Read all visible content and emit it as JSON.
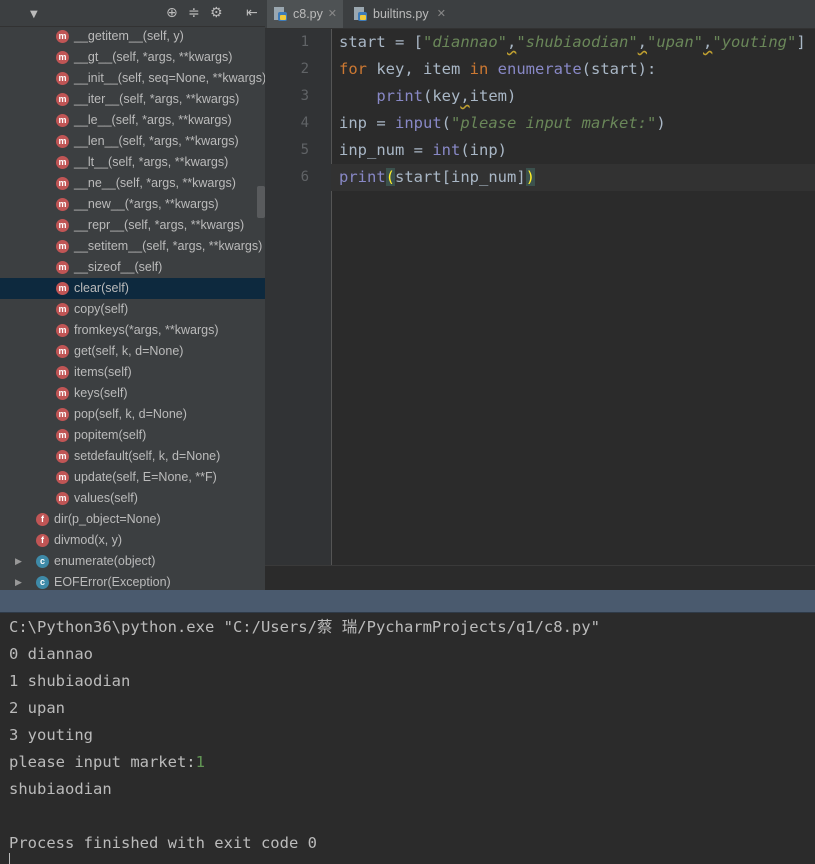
{
  "structure": {
    "toolbar": {
      "collapse_icon": "chevron-down-icon",
      "icons": [
        "target-icon",
        "split-icon",
        "gear-icon",
        "pin-left-icon"
      ]
    },
    "items": [
      {
        "badge": "m",
        "label": "__getitem__(self, y)",
        "indent": 2
      },
      {
        "badge": "m",
        "label": "__gt__(self, *args, **kwargs)",
        "indent": 2
      },
      {
        "badge": "m",
        "label": "__init__(self, seq=None, **kwargs)",
        "indent": 2
      },
      {
        "badge": "m",
        "label": "__iter__(self, *args, **kwargs)",
        "indent": 2
      },
      {
        "badge": "m",
        "label": "__le__(self, *args, **kwargs)",
        "indent": 2
      },
      {
        "badge": "m",
        "label": "__len__(self, *args, **kwargs)",
        "indent": 2
      },
      {
        "badge": "m",
        "label": "__lt__(self, *args, **kwargs)",
        "indent": 2
      },
      {
        "badge": "m",
        "label": "__ne__(self, *args, **kwargs)",
        "indent": 2
      },
      {
        "badge": "m",
        "label": "__new__(*args, **kwargs)",
        "indent": 2
      },
      {
        "badge": "m",
        "label": "__repr__(self, *args, **kwargs)",
        "indent": 2
      },
      {
        "badge": "m",
        "label": "__setitem__(self, *args, **kwargs)",
        "indent": 2
      },
      {
        "badge": "m",
        "label": "__sizeof__(self)",
        "indent": 2
      },
      {
        "badge": "m",
        "label": "clear(self)",
        "indent": 2,
        "selected": true
      },
      {
        "badge": "m",
        "label": "copy(self)",
        "indent": 2
      },
      {
        "badge": "m",
        "label": "fromkeys(*args, **kwargs)",
        "indent": 2
      },
      {
        "badge": "m",
        "label": "get(self, k, d=None)",
        "indent": 2
      },
      {
        "badge": "m",
        "label": "items(self)",
        "indent": 2
      },
      {
        "badge": "m",
        "label": "keys(self)",
        "indent": 2
      },
      {
        "badge": "m",
        "label": "pop(self, k, d=None)",
        "indent": 2
      },
      {
        "badge": "m",
        "label": "popitem(self)",
        "indent": 2
      },
      {
        "badge": "m",
        "label": "setdefault(self, k, d=None)",
        "indent": 2
      },
      {
        "badge": "m",
        "label": "update(self, E=None, **F)",
        "indent": 2
      },
      {
        "badge": "m",
        "label": "values(self)",
        "indent": 2
      },
      {
        "badge": "f",
        "label": "dir(p_object=None)",
        "indent": 1
      },
      {
        "badge": "f",
        "label": "divmod(x, y)",
        "indent": 1
      },
      {
        "badge": "c",
        "label": "enumerate(object)",
        "indent": 1,
        "expandable": true
      },
      {
        "badge": "c",
        "label": "EOFError(Exception)",
        "indent": 1,
        "expandable": true
      }
    ]
  },
  "tabs": [
    {
      "label": "c8.py",
      "active": true
    },
    {
      "label": "builtins.py",
      "active": false
    }
  ],
  "editor": {
    "line_numbers": [
      "1",
      "2",
      "3",
      "4",
      "5",
      "6"
    ],
    "lines": [
      "start = [\"diannao\",\"shubiaodian\",\"upan\",\"youting\"]",
      "for key, item in enumerate(start):",
      "    print(key,item)",
      "inp = input(\"please input market:\")",
      "inp_num = int(inp)",
      "print(start[inp_num])"
    ]
  },
  "console": {
    "lines": [
      "C:\\Python36\\python.exe \"C:/Users/蔡 瑞/PycharmProjects/q1/c8.py\"",
      "0 diannao",
      "1 shubiaodian",
      "2 upan",
      "3 youting",
      "please input market:",
      "shubiaodian",
      "",
      "Process finished with exit code 0"
    ],
    "user_input": "1"
  }
}
